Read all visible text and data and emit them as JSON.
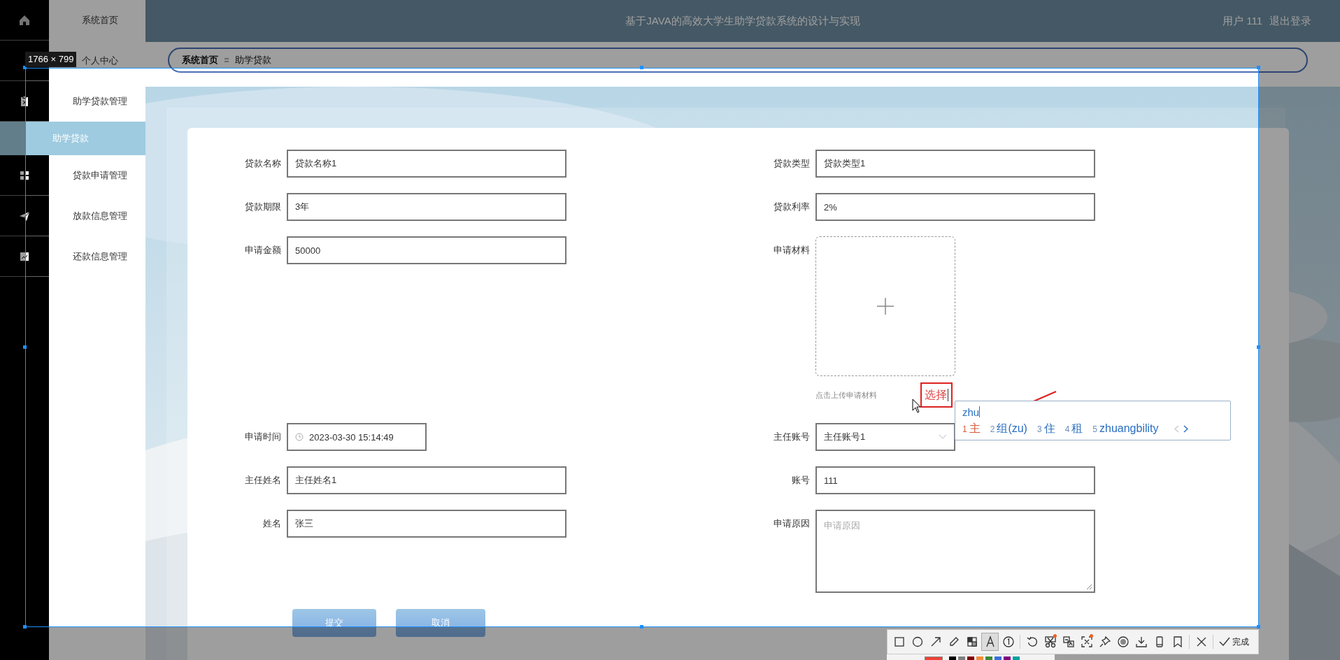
{
  "header": {
    "title": "基于JAVA的高效大学生助学贷款系统的设计与实现",
    "user": "用户 111",
    "logout": "退出登录"
  },
  "sidebar": {
    "items": [
      {
        "label": "系统首页",
        "kind": "menu",
        "selected": false
      },
      {
        "label": "个人中心",
        "kind": "menu",
        "selected": false
      },
      {
        "label": "助学贷款管理",
        "kind": "menu",
        "selected": false
      },
      {
        "label": "助学贷款",
        "kind": "submenu",
        "selected": true
      },
      {
        "label": "贷款申请管理",
        "kind": "menu",
        "selected": false
      },
      {
        "label": "放款信息管理",
        "kind": "menu",
        "selected": false
      },
      {
        "label": "还款信息管理",
        "kind": "menu",
        "selected": false
      }
    ]
  },
  "breadcrumb": [
    "系统首页",
    "助学贷款"
  ],
  "form": {
    "rows": [
      [
        {
          "label": "贷款名称",
          "kind": "text",
          "value": "贷款名称1"
        },
        {
          "label": "贷款类型",
          "kind": "text",
          "value": "贷款类型1"
        }
      ],
      [
        {
          "label": "贷款期限",
          "kind": "text",
          "value": "3年"
        },
        {
          "label": "贷款利率",
          "kind": "text",
          "value": "2%"
        }
      ],
      [
        {
          "label": "申请金额",
          "kind": "text",
          "value": "50000"
        },
        {
          "label": "申请材料",
          "kind": "upload",
          "hint": "点击上传申请材料",
          "button": "选择"
        }
      ],
      [
        {
          "label": "申请时间",
          "kind": "date",
          "value": "2023-03-30 15:14:49"
        },
        {
          "label": "主任账号",
          "kind": "select",
          "value": "主任账号1"
        }
      ],
      [
        {
          "label": "主任姓名",
          "kind": "text",
          "value": "主任姓名1"
        },
        {
          "label": "账号",
          "kind": "text",
          "value": "111"
        }
      ],
      [
        {
          "label": "姓名",
          "kind": "text",
          "value": "张三"
        },
        {
          "label": "申请原因",
          "kind": "textarea",
          "placeholder": "申请原因"
        }
      ]
    ],
    "buttons": [
      "提交",
      "取消"
    ]
  },
  "ime": {
    "composition": "zhu",
    "candidates": [
      {
        "number": "1",
        "text": "主",
        "selected": true
      },
      {
        "number": "2",
        "text": "组(zu)",
        "selected": false
      },
      {
        "number": "3",
        "text": "住",
        "selected": false
      },
      {
        "number": "4",
        "text": "租",
        "selected": false
      },
      {
        "number": "5",
        "text": "zhuangbility",
        "selected": false
      }
    ],
    "prev_disabled": true,
    "next_disabled": false
  },
  "capture": {
    "size": "1766 × 799",
    "toolbar": {
      "groups": [
        [
          {
            "kind": "rectangle",
            "selected": false,
            "badge": false
          },
          {
            "kind": "ellipse",
            "selected": false,
            "badge": false
          },
          {
            "kind": "arrow",
            "selected": false,
            "badge": false
          },
          {
            "kind": "pencil",
            "selected": false,
            "badge": false
          },
          {
            "kind": "mosaic",
            "selected": false,
            "badge": false
          },
          {
            "kind": "text",
            "selected": true,
            "badge": false
          },
          {
            "kind": "number",
            "selected": false,
            "badge": false
          }
        ],
        [
          {
            "kind": "undo",
            "selected": false,
            "badge": false
          },
          {
            "kind": "scissors",
            "selected": false,
            "badge": true
          },
          {
            "kind": "translate",
            "selected": false,
            "badge": false
          },
          {
            "kind": "ocr",
            "selected": false,
            "badge": true
          },
          {
            "kind": "pin",
            "selected": false,
            "badge": false
          },
          {
            "kind": "record",
            "selected": false,
            "badge": false
          },
          {
            "kind": "download",
            "selected": false,
            "badge": false
          },
          {
            "kind": "phone",
            "selected": false,
            "badge": false
          },
          {
            "kind": "bookmark",
            "selected": false,
            "badge": false
          }
        ],
        [
          {
            "kind": "close",
            "selected": false,
            "badge": false
          }
        ]
      ],
      "done": "完成"
    },
    "palette": [
      {
        "color": "#f04134",
        "selected": true
      },
      {
        "color": "#000000",
        "selected": false
      },
      {
        "color": "#808080",
        "selected": false
      },
      {
        "color": "#800000",
        "selected": false
      },
      {
        "color": "#f08c3c",
        "selected": false
      },
      {
        "color": "#3a8a3a",
        "selected": false
      },
      {
        "color": "#3a6fd8",
        "selected": false
      },
      {
        "color": "#800080",
        "selected": false
      },
      {
        "color": "#00a0a0",
        "selected": false
      }
    ]
  }
}
